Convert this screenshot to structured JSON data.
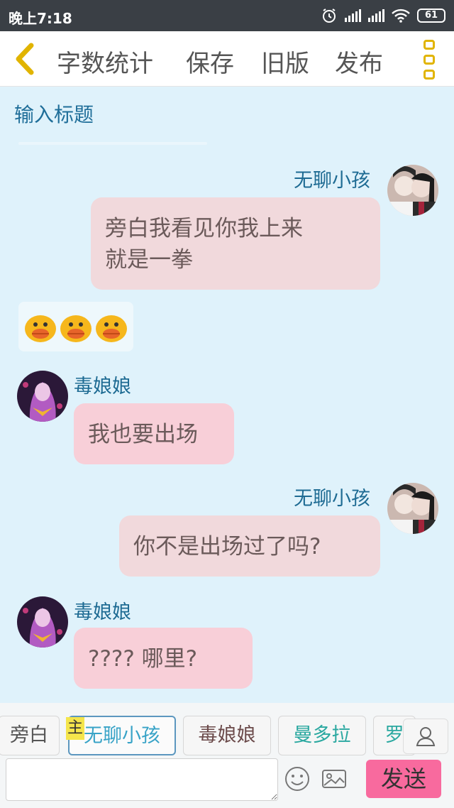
{
  "status_bar": {
    "time": "晚上7:18",
    "battery": "61"
  },
  "toolbar": {
    "word_count": "字数统计",
    "save": "保存",
    "old_version": "旧版",
    "publish": "发布"
  },
  "title_input": {
    "placeholder": "输入标题"
  },
  "messages": [
    {
      "side": "right",
      "speaker": "无聊小孩",
      "lines": [
        "旁白我看见你我上来",
        "就是一拳"
      ]
    },
    {
      "side": "left",
      "type": "emoji",
      "count": 3
    },
    {
      "side": "left",
      "speaker": "毒娘娘",
      "text": "我也要出场"
    },
    {
      "side": "right",
      "speaker": "无聊小孩",
      "text": "你不是出场过了吗?"
    },
    {
      "side": "left",
      "speaker": "毒娘娘",
      "text": "???? 哪里?"
    }
  ],
  "roles": {
    "items": [
      {
        "label": "旁白",
        "color": "#555555"
      },
      {
        "label": "无聊小孩",
        "color": "#38a3c7",
        "selected": true
      },
      {
        "label": "毒娘娘",
        "color": "#6b4a4a"
      },
      {
        "label": "曼多拉",
        "color": "#2aa8a0"
      },
      {
        "label": "罗",
        "color": "#2aa8a0"
      }
    ],
    "main_badge": "主"
  },
  "composer": {
    "send": "发送"
  },
  "colors": {
    "accent_yellow": "#e1b400",
    "send_pink": "#f86a9e",
    "bubble_right": "#f1d9dc",
    "bubble_left": "#f8cfd8",
    "background": "#dff2fb"
  }
}
